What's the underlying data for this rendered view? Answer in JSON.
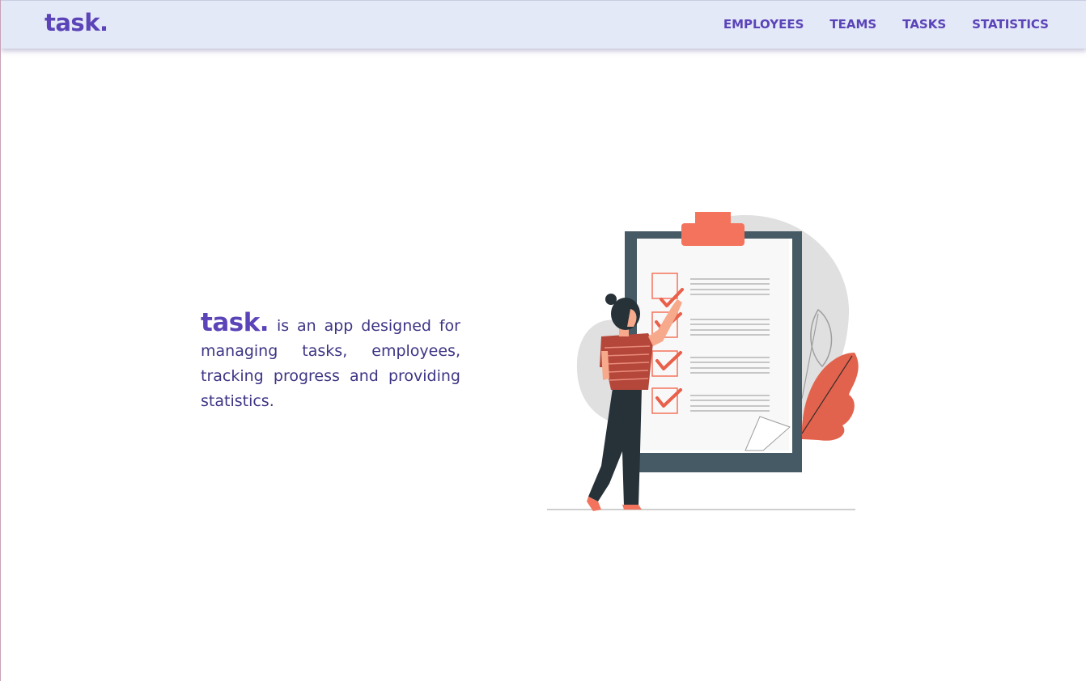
{
  "nav": {
    "logo": "task.",
    "links": [
      {
        "label": "EMPLOYEES"
      },
      {
        "label": "TEAMS"
      },
      {
        "label": "TASKS"
      },
      {
        "label": "STATISTICS"
      }
    ]
  },
  "hero": {
    "brand": "task.",
    "description": "is an app designed for managing tasks, employees, tracking progress and providing statistics."
  },
  "colors": {
    "accent": "#5b44b8",
    "navbar_bg": "#e4e9f8",
    "text": "#3d3585",
    "illustration_coral": "#f4735c",
    "illustration_board": "#455a64"
  },
  "illustration": {
    "icon": "checklist-clipboard-person-illustration"
  }
}
